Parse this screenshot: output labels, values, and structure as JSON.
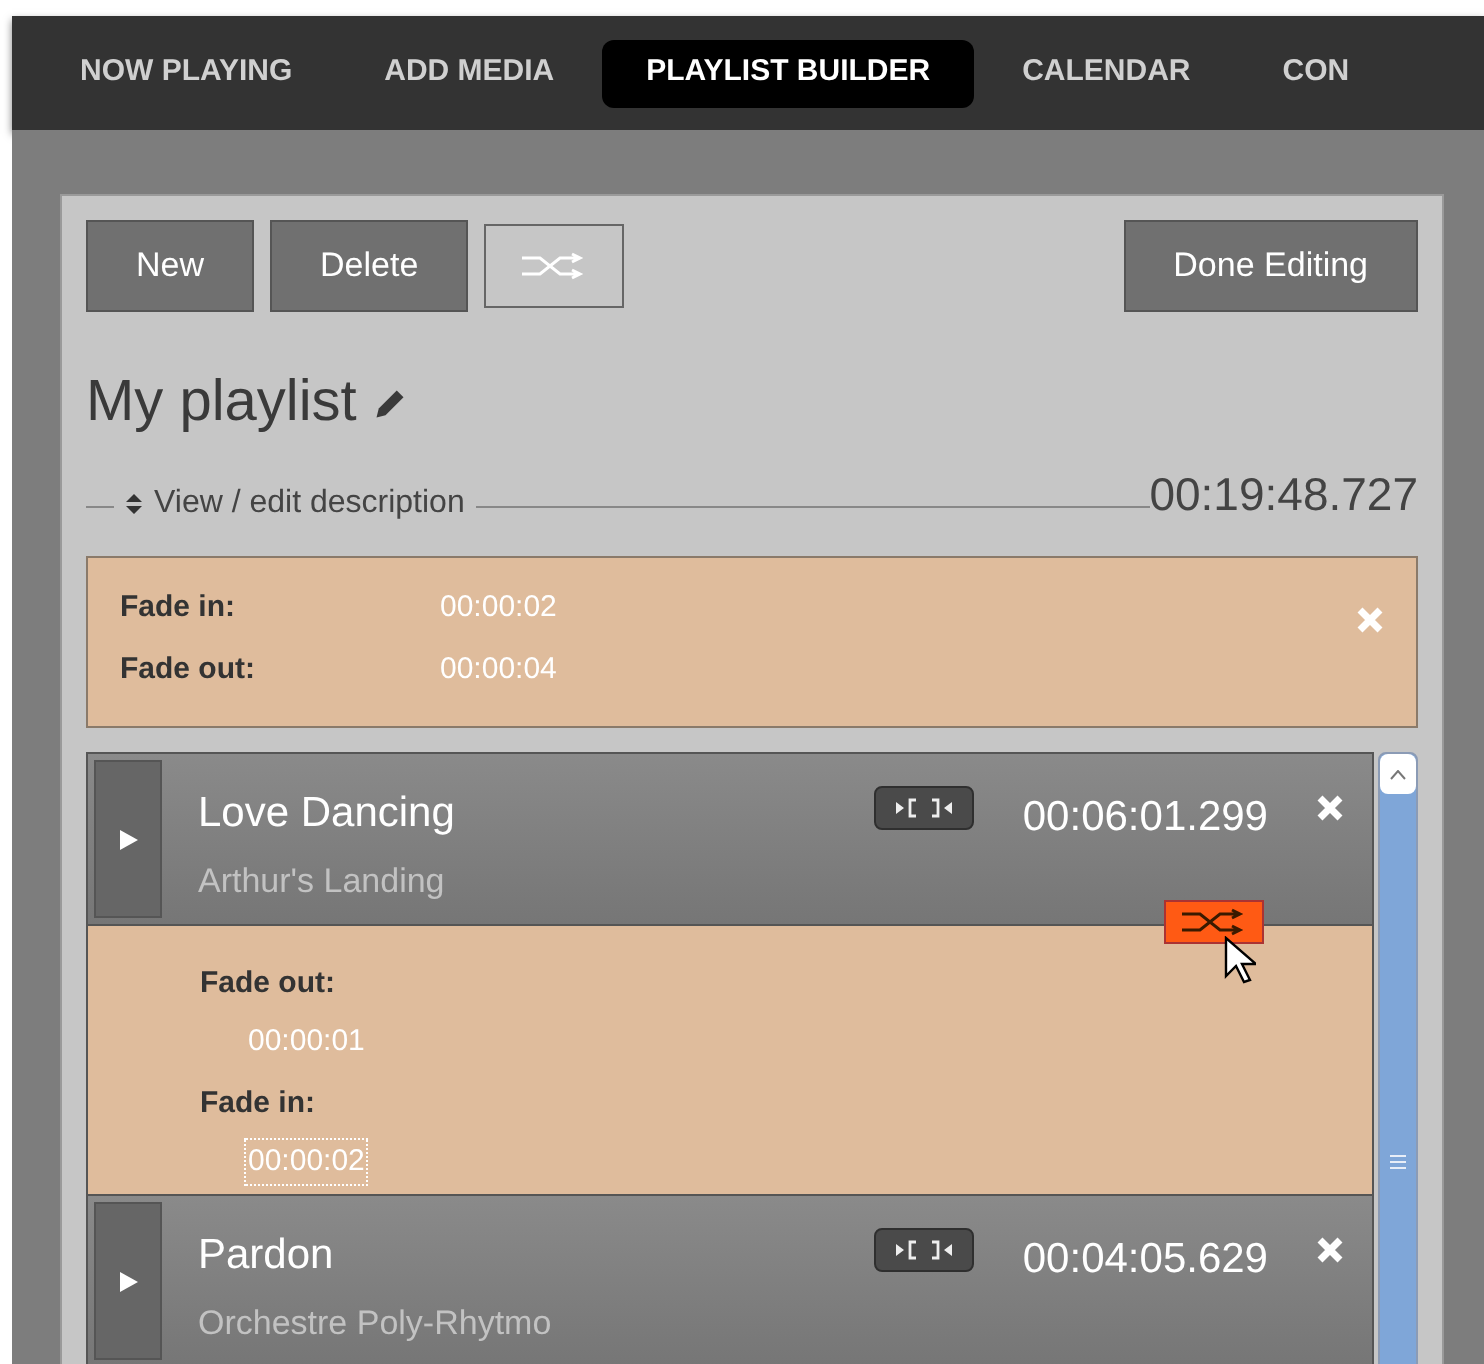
{
  "tabs": [
    {
      "label": "NOW PLAYING",
      "selected": false
    },
    {
      "label": "ADD MEDIA",
      "selected": false
    },
    {
      "label": "PLAYLIST BUILDER",
      "selected": true
    },
    {
      "label": "CALENDAR",
      "selected": false
    },
    {
      "label": "CON",
      "selected": false
    }
  ],
  "toolbar": {
    "buttons": [
      "New",
      "Delete"
    ],
    "done_button": "Done Editing"
  },
  "playlist": {
    "title": "My playlist",
    "description_toggle": "View / edit description",
    "total_duration": "00:19:48.727",
    "fades": [
      {
        "label": "Fade in:",
        "value": "00:00:02"
      },
      {
        "label": "Fade out:",
        "value": "00:00:04"
      }
    ],
    "tracks": [
      {
        "title": "Love Dancing",
        "artist": "Arthur's Landing",
        "duration": "00:06:01.299",
        "expanded": true,
        "fades": [
          {
            "label": "Fade out:",
            "value": "00:00:01",
            "focused": false
          },
          {
            "label": "Fade in:",
            "value": "00:00:02",
            "focused": true
          }
        ]
      },
      {
        "title": "Pardon",
        "artist": "Orchestre Poly-Rhytmo",
        "duration": "00:04:05.629",
        "expanded": false
      }
    ]
  }
}
